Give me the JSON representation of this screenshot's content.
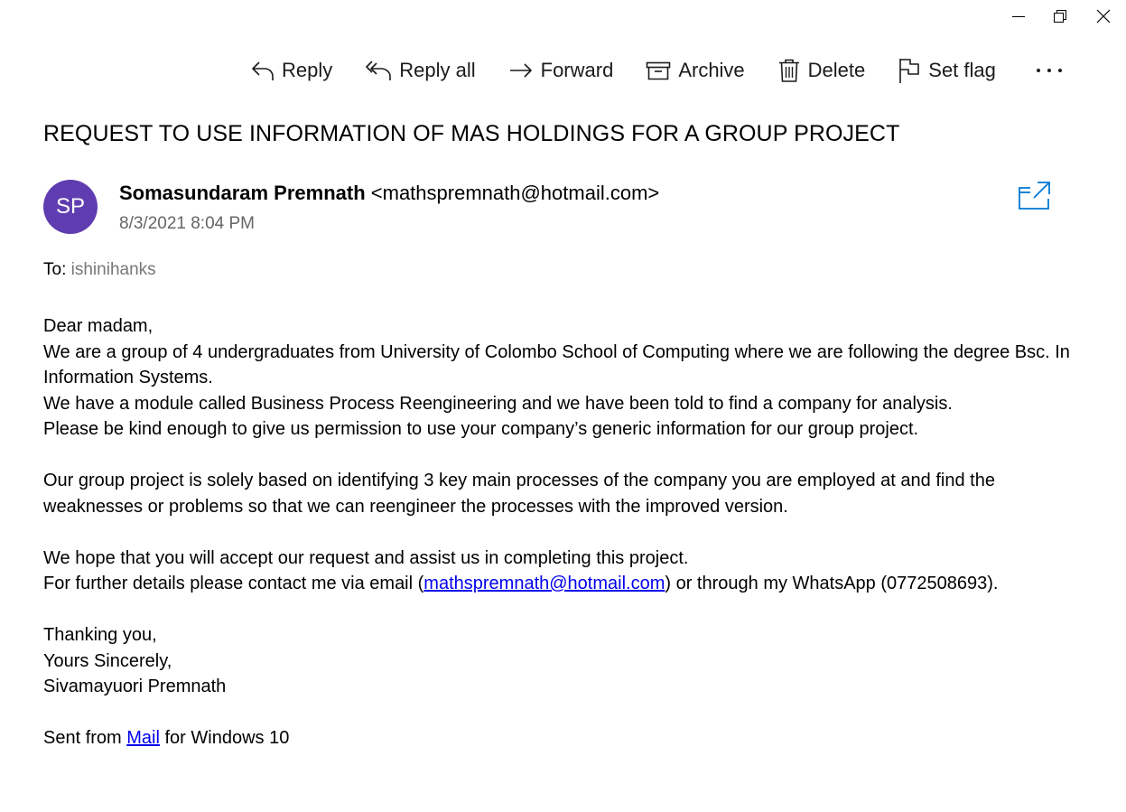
{
  "toolbar": {
    "reply": "Reply",
    "reply_all": "Reply all",
    "forward": "Forward",
    "archive": "Archive",
    "delete": "Delete",
    "set_flag": "Set flag",
    "more": "•••"
  },
  "email": {
    "subject": "REQUEST TO USE INFORMATION OF MAS HOLDINGS FOR A GROUP PROJECT",
    "avatar_initials": "SP",
    "avatar_color": "#5f3db0",
    "sender_name": "Somasundaram Premnath",
    "sender_email_display": "<mathspremnath@hotmail.com>",
    "date": "8/3/2021 8:04 PM",
    "to_label": "To:",
    "to_recipient": "ishinihanks"
  },
  "body": {
    "greeting": "Dear madam,",
    "p1": "We are a group of 4 undergraduates from University of Colombo School of Computing where we are following the degree Bsc. In Information Systems.",
    "p2": "We have a module called Business Process Reengineering and we have been told to find a company for analysis.",
    "p3": "Please be kind enough to give us permission to use your company’s generic information for our group project.",
    "p4": "Our group project is solely based on identifying 3 key main processes of the company you are employed at and find the weaknesses or problems so that we can reengineer the processes with the improved version.",
    "p5": "We hope that you will accept our request and assist us in completing this project.",
    "p6_before": "For further details please contact me via email (",
    "p6_link": "mathspremnath@hotmail.com",
    "p6_after": ") or through my WhatsApp (0772508693).",
    "closing1": "Thanking you,",
    "closing2": "Yours Sincerely,",
    "signature": "Sivamayuori Premnath",
    "sent_from_before": "Sent from ",
    "sent_from_link": "Mail",
    "sent_from_after": " for Windows 10"
  },
  "colors": {
    "link": "#0000ee",
    "accent": "#0078d4"
  }
}
